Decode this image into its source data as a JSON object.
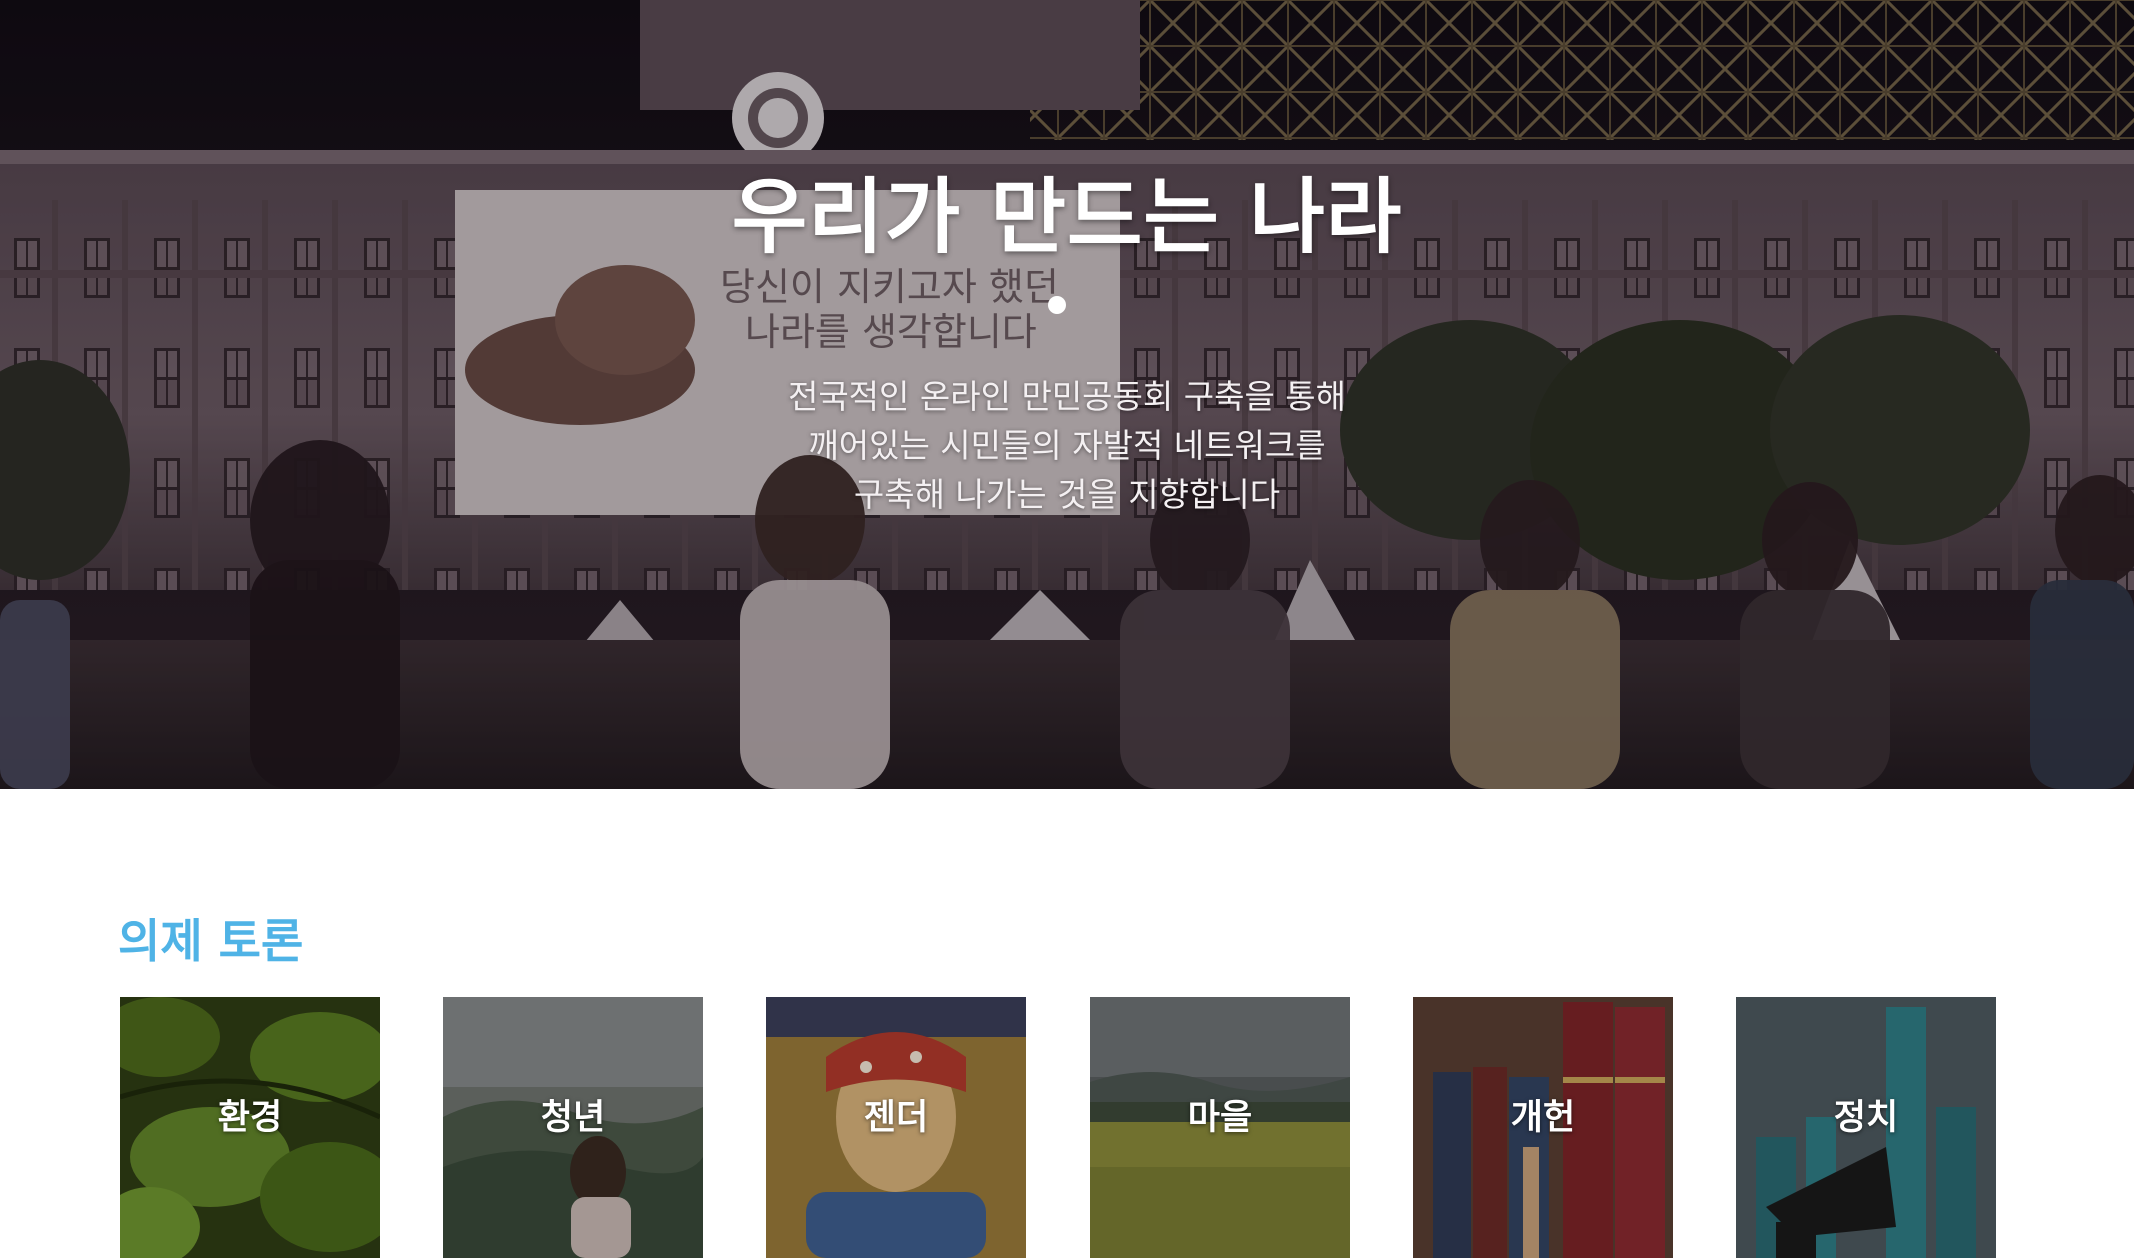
{
  "hero": {
    "title": "우리가 만드는 나라",
    "tagline": [
      "전국적인 온라인 만민공동회 구축을 통해",
      "깨어있는 시민들의 자발적 네트워크를",
      "구축해 나가는 것을 지향합니다"
    ],
    "banner_text": [
      "당신이 지키고자 했던",
      "나라를 생각합니다"
    ]
  },
  "topics": {
    "heading": "의제 토론",
    "heading_color": "#4fb3e6",
    "items": [
      {
        "label": "환경",
        "icon": "leaves-image"
      },
      {
        "label": "청년",
        "icon": "misty-forest-image"
      },
      {
        "label": "젠더",
        "icon": "mural-image"
      },
      {
        "label": "마을",
        "icon": "field-image"
      },
      {
        "label": "개헌",
        "icon": "books-image"
      },
      {
        "label": "정치",
        "icon": "megaphone-skyline-image"
      }
    ]
  }
}
